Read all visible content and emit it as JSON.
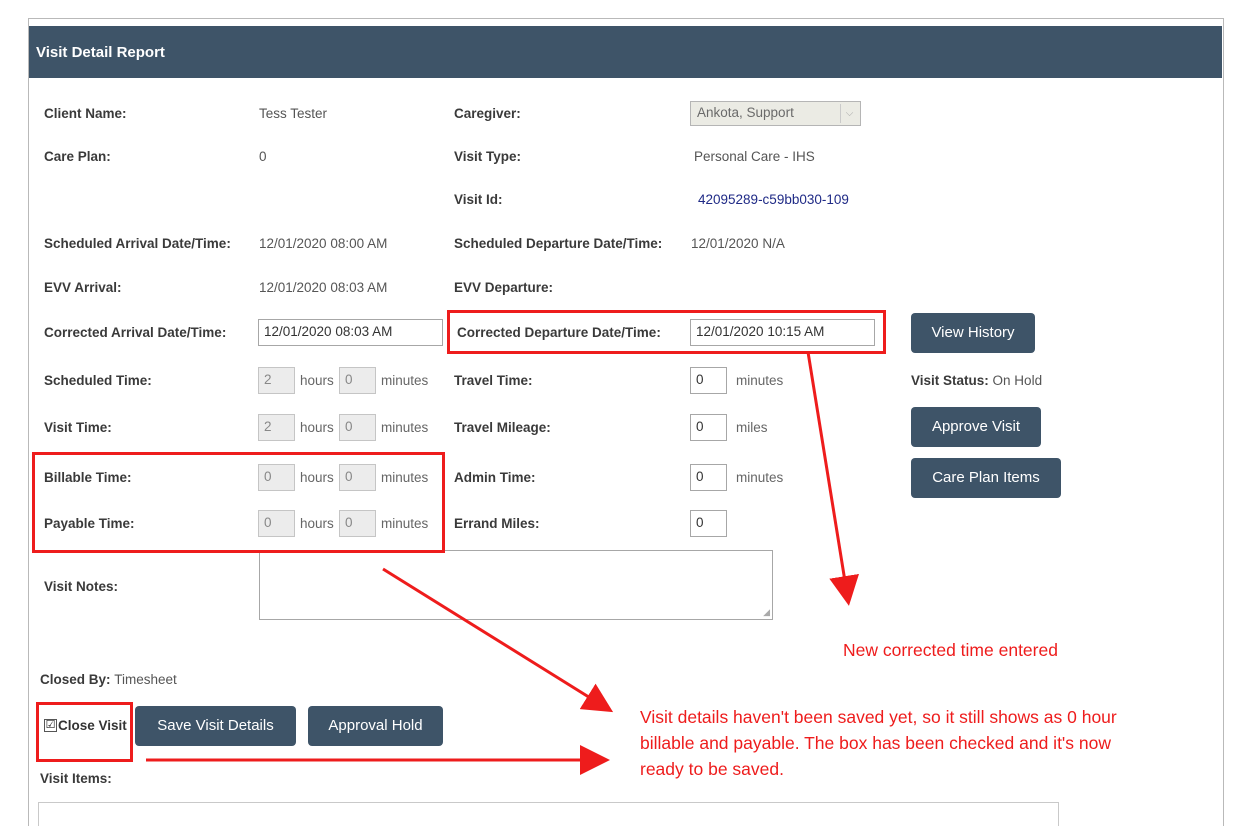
{
  "header": {
    "title": "Visit Detail Report"
  },
  "fields": {
    "client_name_label": "Client Name:",
    "client_name": "Tess Tester",
    "caregiver_label": "Caregiver:",
    "caregiver": "Ankota, Support",
    "care_plan_label": "Care Plan:",
    "care_plan": "0",
    "visit_type_label": "Visit Type:",
    "visit_type": "Personal Care - IHS",
    "visit_id_label": "Visit Id:",
    "visit_id": "42095289-c59bb030-109",
    "sched_arrival_label": "Scheduled Arrival Date/Time:",
    "sched_arrival": "12/01/2020 08:00 AM",
    "sched_departure_label": "Scheduled Departure Date/Time:",
    "sched_departure": "12/01/2020 N/A",
    "evv_arrival_label": "EVV Arrival:",
    "evv_arrival": "12/01/2020 08:03 AM",
    "evv_departure_label": "EVV Departure:",
    "corr_arrival_label": "Corrected Arrival Date/Time:",
    "corr_arrival": "12/01/2020 08:03 AM",
    "corr_departure_label": "Corrected Departure Date/Time:",
    "corr_departure": "12/01/2020 10:15 AM",
    "scheduled_time_label": "Scheduled Time:",
    "scheduled_hours": "2",
    "scheduled_minutes": "0",
    "travel_time_label": "Travel Time:",
    "travel_time": "0",
    "visit_status_label": "Visit Status:",
    "visit_status": "On Hold",
    "visit_time_label": "Visit Time:",
    "visit_hours": "2",
    "visit_minutes": "0",
    "travel_mileage_label": "Travel Mileage:",
    "travel_mileage": "0",
    "billable_time_label": "Billable Time:",
    "billable_hours": "0",
    "billable_minutes": "0",
    "admin_time_label": "Admin Time:",
    "admin_time": "0",
    "payable_time_label": "Payable Time:",
    "payable_hours": "0",
    "payable_minutes": "0",
    "errand_miles_label": "Errand Miles:",
    "errand_miles": "0",
    "visit_notes_label": "Visit Notes:",
    "closed_by_label": "Closed By:",
    "closed_by": "Timesheet",
    "close_visit_label": "Close Visit",
    "visit_items_label": "Visit Items:"
  },
  "units": {
    "hours": "hours",
    "minutes": "minutes",
    "miles": "miles"
  },
  "buttons": {
    "view_history": "View History",
    "approve_visit": "Approve Visit",
    "care_plan_items": "Care Plan Items",
    "save_visit_details": "Save Visit Details",
    "approval_hold": "Approval Hold"
  },
  "annotations": {
    "corrected_time": "New corrected time entered",
    "not_saved_line1": "Visit details haven't been saved yet, so it still shows as 0 hour",
    "not_saved_line2": "billable and payable. The box has been checked and it's now",
    "not_saved_line3": "ready to be saved."
  },
  "colors": {
    "header": "#3e5468",
    "button": "#3e5468",
    "annotation": "#ee1c1c",
    "link": "#1f2a86"
  },
  "checkbox": {
    "close_visit_checked": true,
    "glyph": "☑"
  },
  "select": {
    "arrow_glyph": "⌵"
  }
}
